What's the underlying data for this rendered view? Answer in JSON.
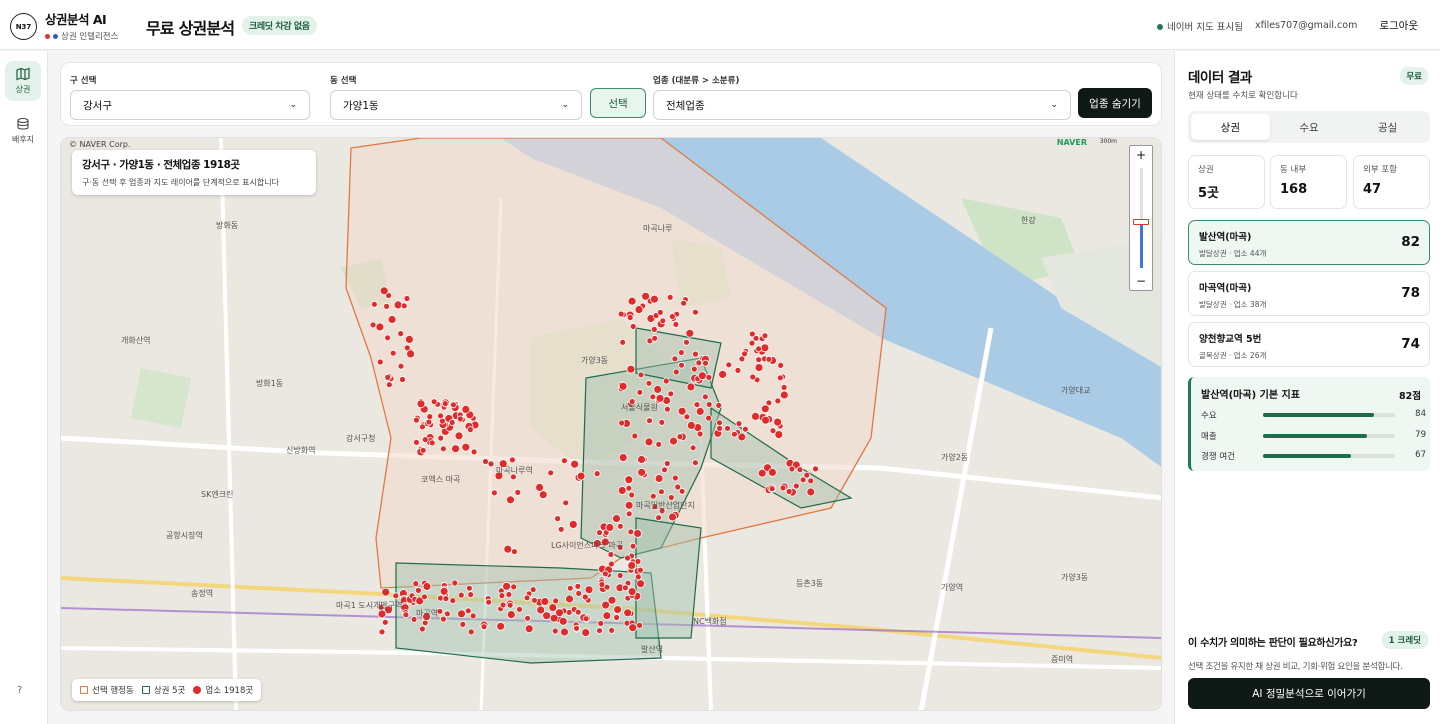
{
  "header": {
    "logo_text": "N37",
    "brand_title": "상권분석 AI",
    "brand_sub": "상권 인텔리전스",
    "page_title": "무료 상권분석",
    "credit_badge": "크레딧 차감 없음",
    "map_status": "네이버 지도 표시됨",
    "email": "xfiles707@gmail.com",
    "logout": "로그아웃"
  },
  "nav": {
    "items": [
      {
        "label": "상권",
        "icon": "map-icon"
      },
      {
        "label": "배후지",
        "icon": "database-icon"
      }
    ],
    "help": "?"
  },
  "filters": {
    "district_label": "구 선택",
    "district_value": "강서구",
    "dong_label": "동 선택",
    "dong_value": "가양1동",
    "select_button": "선택",
    "industry_label": "업종 (대분류 > 소분류)",
    "industry_value": "전체업종",
    "hide_button": "업종 숨기기"
  },
  "map": {
    "copyright": "© NAVER Corp.",
    "naver": "NAVER",
    "scale": "300m",
    "info_title": "강서구 · 가양1동 · 전체업종 1918곳",
    "info_sub": "구·동 선택 후 업종과 지도 레이어를 단계적으로 표시합니다",
    "zoom_in": "+",
    "zoom_out": "−",
    "legend": [
      {
        "label": "선택 행정동",
        "color": "#e07a45"
      },
      {
        "label": "상권 5곳",
        "color": "#1f6b4a"
      },
      {
        "label": "업소 1918곳",
        "color": "#e02b2b"
      }
    ],
    "place_labels": [
      "방화동",
      "개화산역",
      "신방화역",
      "공항시장역",
      "송정역",
      "방화1동",
      "마곡나루역",
      "마곡역",
      "발산역",
      "가양3동",
      "가양2동",
      "가양3동",
      "등촌3동",
      "가양역",
      "증미역",
      "마곡1 도시개발구역",
      "한강",
      "가양대교",
      "마곡일반산업단지",
      "마곡나루",
      "서울식물원",
      "강서구청",
      "LG사이언스파크 마곡",
      "SK엔크린",
      "코엑스 마곡",
      "NC백화점"
    ]
  },
  "panel": {
    "title": "데이터 결과",
    "free_badge": "무료",
    "subtitle": "현재 상태를 수치로 확인합니다",
    "tabs": [
      "상권",
      "수요",
      "공실"
    ],
    "stats": [
      {
        "label": "상권",
        "value": "5곳"
      },
      {
        "label": "동 내부",
        "value": "168"
      },
      {
        "label": "외부 포함",
        "value": "47"
      }
    ],
    "zones": [
      {
        "name": "발산역(마곡)",
        "desc": "발달상권 · 업소 44개",
        "score": "82"
      },
      {
        "name": "마곡역(마곡)",
        "desc": "발달상권 · 업소 38개",
        "score": "78"
      },
      {
        "name": "양천향교역 5번",
        "desc": "골목상권 · 업소 26개",
        "score": "74"
      }
    ],
    "indicator": {
      "title": "발산역(마곡) 기본 지표",
      "score": "82점",
      "rows": [
        {
          "label": "수요",
          "value": 84
        },
        {
          "label": "매출",
          "value": 79
        },
        {
          "label": "경쟁 여건",
          "value": 67
        }
      ]
    },
    "cta_question": "이 수치가 의미하는 판단이 필요하신가요?",
    "cta_badge": "1 크레딧",
    "cta_desc": "선택 조건을 유지한 채 상권 비교, 기회·위험 요인을 분석합니다.",
    "cta_button": "AI 정밀분석으로 이어가기"
  },
  "colors": {
    "accent": "#1f6b4a",
    "dark": "#0f1a16",
    "store_dot": "#e02b2b",
    "district_border": "#e07a45",
    "river": "#aacbe6"
  }
}
